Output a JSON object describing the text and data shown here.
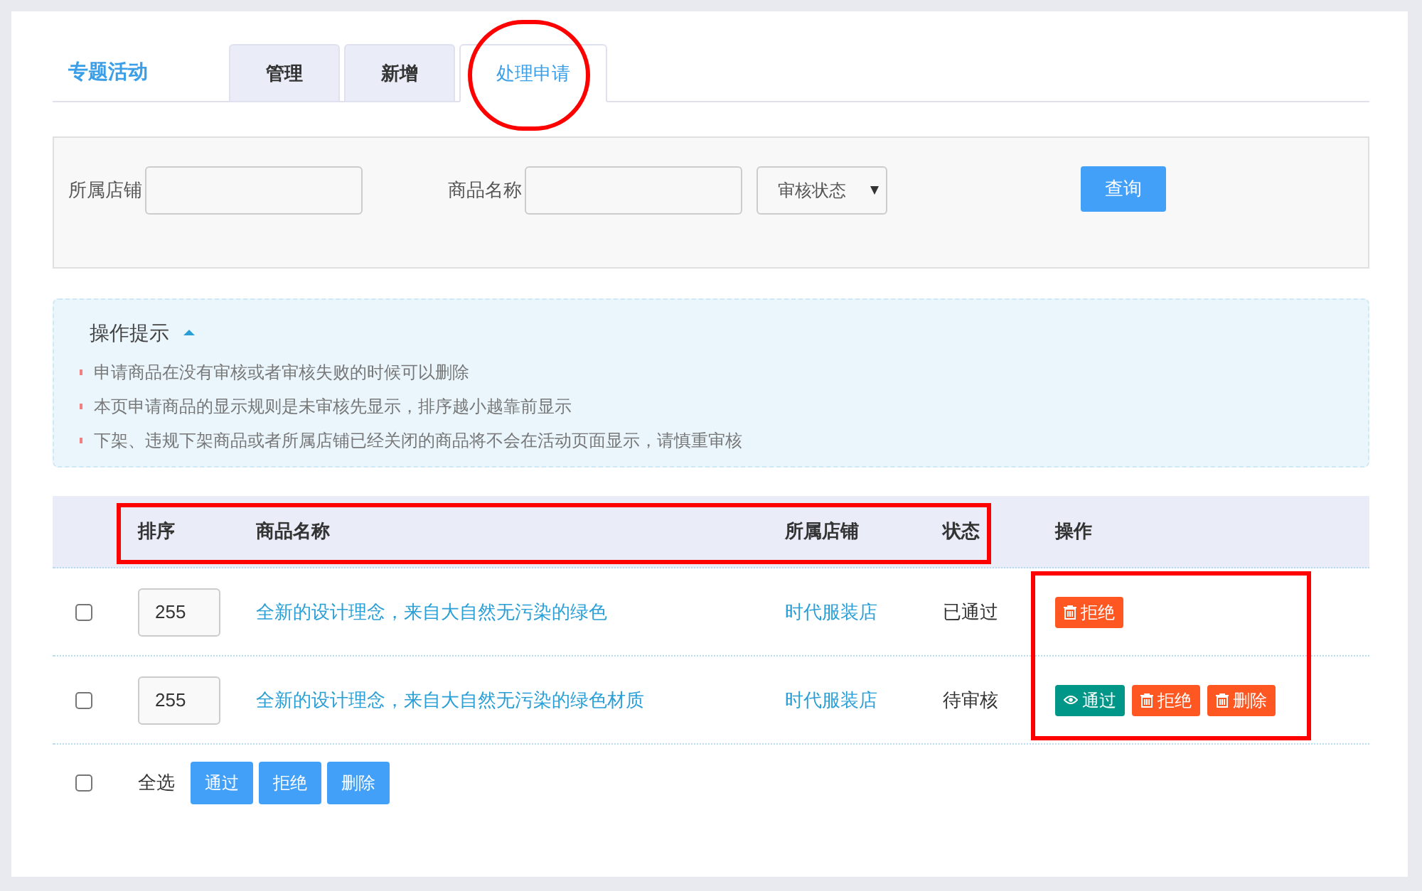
{
  "page_title": "专题活动",
  "tabs": [
    {
      "label": "管理",
      "selected": false,
      "circled": false
    },
    {
      "label": "新增",
      "selected": false,
      "circled": false
    },
    {
      "label": "处理申请",
      "selected": true,
      "circled": true
    }
  ],
  "filters": {
    "fields": [
      {
        "label": "所属店铺"
      },
      {
        "label": "商品名称"
      }
    ],
    "status_select": {
      "value": "审核状态"
    },
    "search_button": "查询"
  },
  "tips": {
    "title": "操作提示",
    "expanded": true,
    "items": [
      "申请商品在没有审核或者审核失败的时候可以删除",
      "本页申请商品的显示规则是未审核先显示，排序越小越靠前显示",
      "下架、违规下架商品或者所属店铺已经关闭的商品将不会在活动页面显示，请慎重审核"
    ]
  },
  "table": {
    "columns": [
      "排序",
      "商品名称",
      "所属店铺",
      "状态",
      "操作"
    ],
    "columns_framed": true,
    "actions_framed": true,
    "rows": [
      {
        "checked": false,
        "sort": "255",
        "name": "全新的设计理念，来自大自然无污染的绿色",
        "shop": "时代服装店",
        "status": "已通过",
        "actions": [
          {
            "kind": "reject",
            "label": "拒绝"
          }
        ]
      },
      {
        "checked": false,
        "sort": "255",
        "name": "全新的设计理念，来自大自然无污染的绿色材质",
        "shop": "时代服装店",
        "status": "待审核",
        "actions": [
          {
            "kind": "approve",
            "label": "通过"
          },
          {
            "kind": "reject",
            "label": "拒绝"
          },
          {
            "kind": "delete",
            "label": "删除"
          }
        ]
      }
    ]
  },
  "bulk": {
    "checked": false,
    "label": "全选",
    "buttons": [
      "通过",
      "拒绝",
      "删除"
    ]
  }
}
